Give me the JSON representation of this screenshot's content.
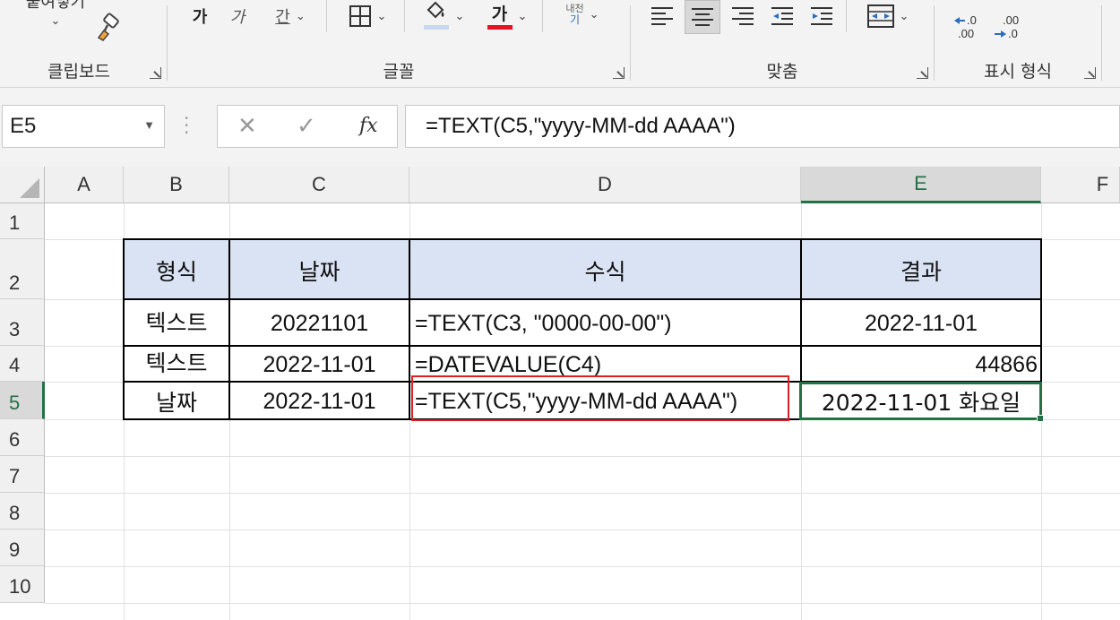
{
  "ribbon": {
    "clipboard": {
      "paste_label": "붙여넣기",
      "group_label": "클립보드"
    },
    "font": {
      "bold": "가",
      "italic": "가",
      "underline": "간",
      "font_color": "가",
      "phonetic": "내천",
      "group_label": "글꼴",
      "font_color_hex": "#e81123"
    },
    "alignment": {
      "group_label": "맞춤"
    },
    "number": {
      "decimal_increase": ".0 .00",
      "decimal_decrease": ".00 .0",
      "group_label": "표시 형식"
    }
  },
  "formula_bar": {
    "name_box": "E5",
    "fx": "fx",
    "formula": "=TEXT(C5,\"yyyy-MM-dd AAAA\")"
  },
  "grid": {
    "columns": [
      "A",
      "B",
      "C",
      "D",
      "E",
      "F"
    ],
    "rows": [
      "1",
      "2",
      "3",
      "4",
      "5",
      "6",
      "7",
      "8",
      "9",
      "10"
    ],
    "selected_column": "E",
    "selected_row": "5"
  },
  "table": {
    "headers": {
      "format": "형식",
      "date": "날짜",
      "formula": "수식",
      "result": "결과"
    },
    "rows": [
      {
        "format": "텍스트",
        "date": "20221101",
        "formula": "=TEXT(C3, \"0000-00-00\")",
        "result": "2022-11-01"
      },
      {
        "format": "텍스트",
        "date": "2022-11-01",
        "formula": "=DATEVALUE(C4)",
        "result": "44866"
      },
      {
        "format": "날짜",
        "date": "2022-11-01",
        "formula": "=TEXT(C5,\"yyyy-MM-dd AAAA\")",
        "result": "2022-11-01 화요일"
      }
    ],
    "header_fill": "#dae3f3"
  },
  "colors": {
    "accent": "#217346",
    "highlight": "#e02020"
  }
}
